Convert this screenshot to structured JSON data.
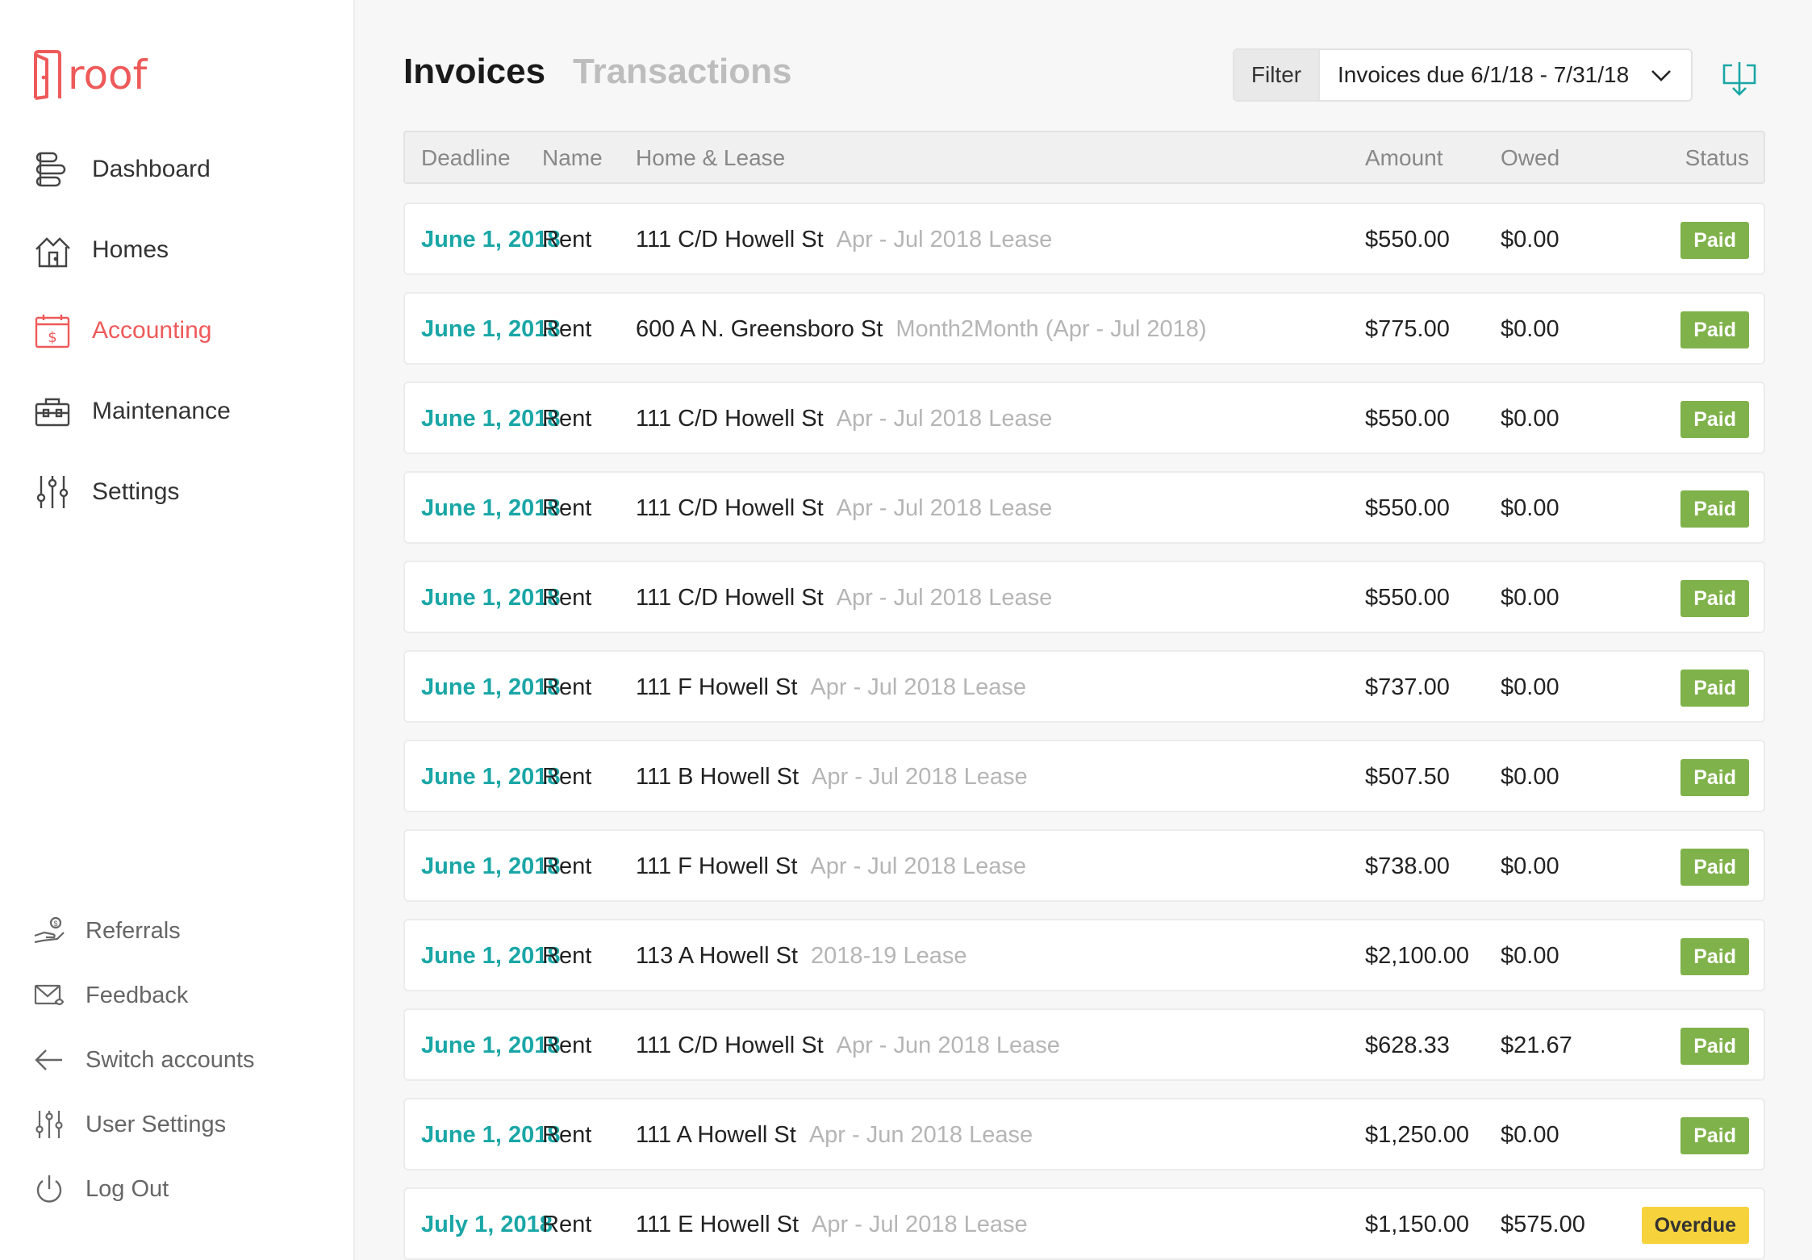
{
  "brand": {
    "name": "roof",
    "color": "#ee5a5a"
  },
  "sidebar": {
    "nav": [
      {
        "label": "Dashboard",
        "icon": "dashboard-icon"
      },
      {
        "label": "Homes",
        "icon": "homes-icon"
      },
      {
        "label": "Accounting",
        "icon": "accounting-icon",
        "active": true
      },
      {
        "label": "Maintenance",
        "icon": "maintenance-icon"
      },
      {
        "label": "Settings",
        "icon": "settings-sliders-icon"
      }
    ],
    "bottom": [
      {
        "label": "Referrals",
        "icon": "referrals-icon"
      },
      {
        "label": "Feedback",
        "icon": "feedback-icon"
      },
      {
        "label": "Switch accounts",
        "icon": "arrow-left-icon"
      },
      {
        "label": "User Settings",
        "icon": "user-settings-sliders-icon"
      },
      {
        "label": "Log Out",
        "icon": "power-icon"
      }
    ]
  },
  "tabs": {
    "invoices": "Invoices",
    "transactions": "Transactions"
  },
  "filter": {
    "label": "Filter",
    "value": "Invoices due 6/1/18 - 7/31/18"
  },
  "table": {
    "headers": {
      "deadline": "Deadline",
      "name": "Name",
      "home": "Home & Lease",
      "amount": "Amount",
      "owed": "Owed",
      "status": "Status"
    },
    "rows": [
      {
        "deadline": "June 1, 2018",
        "name": "Rent",
        "home": "111 C/D Howell St",
        "lease": "Apr - Jul 2018 Lease",
        "amount": "$550.00",
        "owed": "$0.00",
        "status": "Paid"
      },
      {
        "deadline": "June 1, 2018",
        "name": "Rent",
        "home": "600 A N. Greensboro St",
        "lease": "Month2Month (Apr - Jul 2018)",
        "amount": "$775.00",
        "owed": "$0.00",
        "status": "Paid"
      },
      {
        "deadline": "June 1, 2018",
        "name": "Rent",
        "home": "111 C/D Howell St",
        "lease": "Apr - Jul 2018 Lease",
        "amount": "$550.00",
        "owed": "$0.00",
        "status": "Paid"
      },
      {
        "deadline": "June 1, 2018",
        "name": "Rent",
        "home": "111 C/D Howell St",
        "lease": "Apr - Jul 2018 Lease",
        "amount": "$550.00",
        "owed": "$0.00",
        "status": "Paid"
      },
      {
        "deadline": "June 1, 2018",
        "name": "Rent",
        "home": "111 C/D Howell St",
        "lease": "Apr - Jul 2018 Lease",
        "amount": "$550.00",
        "owed": "$0.00",
        "status": "Paid"
      },
      {
        "deadline": "June 1, 2018",
        "name": "Rent",
        "home": "111 F Howell St",
        "lease": "Apr - Jul 2018 Lease",
        "amount": "$737.00",
        "owed": "$0.00",
        "status": "Paid"
      },
      {
        "deadline": "June 1, 2018",
        "name": "Rent",
        "home": "111 B Howell St",
        "lease": "Apr - Jul 2018 Lease",
        "amount": "$507.50",
        "owed": "$0.00",
        "status": "Paid"
      },
      {
        "deadline": "June 1, 2018",
        "name": "Rent",
        "home": "111 F Howell St",
        "lease": "Apr - Jul 2018 Lease",
        "amount": "$738.00",
        "owed": "$0.00",
        "status": "Paid"
      },
      {
        "deadline": "June 1, 2018",
        "name": "Rent",
        "home": "113 A Howell St",
        "lease": "2018-19 Lease",
        "amount": "$2,100.00",
        "owed": "$0.00",
        "status": "Paid"
      },
      {
        "deadline": "June 1, 2018",
        "name": "Rent",
        "home": "111 C/D Howell St",
        "lease": "Apr - Jun 2018 Lease",
        "amount": "$628.33",
        "owed": "$21.67",
        "status": "Paid"
      },
      {
        "deadline": "June 1, 2018",
        "name": "Rent",
        "home": "111 A Howell St",
        "lease": "Apr - Jun 2018 Lease",
        "amount": "$1,250.00",
        "owed": "$0.00",
        "status": "Paid"
      },
      {
        "deadline": "July 1, 2018",
        "name": "Rent",
        "home": "111 E Howell St",
        "lease": "Apr - Jul 2018 Lease",
        "amount": "$1,150.00",
        "owed": "$575.00",
        "status": "Overdue"
      }
    ]
  },
  "colors": {
    "accent": "#1aa6a6",
    "paid": "#7fb24a",
    "overdue": "#f6d33c",
    "active_nav": "#ee5a5a"
  }
}
